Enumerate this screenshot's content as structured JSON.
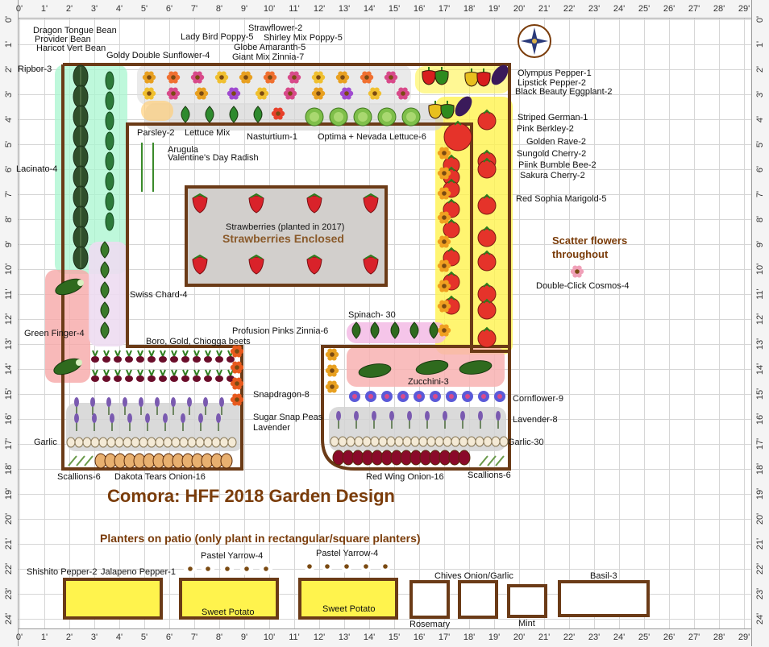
{
  "rulers": {
    "feet": [
      "0'",
      "1'",
      "2'",
      "3'",
      "4'",
      "5'",
      "6'",
      "7'",
      "8'",
      "9'",
      "10'",
      "11'",
      "12'",
      "13'",
      "14'",
      "15'",
      "16'",
      "17'",
      "18'",
      "19'",
      "20'",
      "21'",
      "22'",
      "23'",
      "24'",
      "25'",
      "26'",
      "27'",
      "28'",
      "29'"
    ],
    "rows": [
      "0'",
      "1'",
      "2'",
      "3'",
      "4'",
      "5'",
      "6'",
      "7'",
      "8'",
      "9'",
      "10'",
      "11'",
      "12'",
      "13'",
      "14'",
      "15'",
      "16'",
      "17'",
      "18'",
      "19'",
      "20'",
      "21'",
      "22'",
      "23'",
      "24'"
    ]
  },
  "title": "Comora: HFF 2018 Garden Design",
  "subtitle": "Planters on patio (only plant in rectangular/square planters)",
  "scatter_note": "Scatter flowers throughout",
  "strawberries_enclosed": "Strawberries Enclosed",
  "labels": {
    "dragon_tongue": "Dragon Tongue Bean",
    "provider": "Provider Bean",
    "haricot": "Haricot Vert Bean",
    "ripbor": "Ripbor-3",
    "goldy": "Goldy Double Sunflower-4",
    "ladybird": "Lady Bird Poppy-5",
    "strawflower": "Strawflower-2",
    "shirley": "Shirley Mix Poppy-5",
    "globe": "Globe Amaranth-5",
    "giant_zinnia": "Giant Mix Zinnia-7",
    "olympus": "Olympus Pepper-1",
    "lipstick": "Lipstick Pepper-2",
    "black_beauty": "Black Beauty Eggplant-2",
    "striped_german": "Striped German-1",
    "pink_berkley": "Pink Berkley-2",
    "golden_rave": "Golden Rave-2",
    "sungold": "Sungold Cherry-2",
    "piink_bumble": "Piink Bumble Bee-2",
    "sakura": "Sakura Cherry-2",
    "red_sophia": "Red Sophia Marigold-5",
    "parsley": "Parsley-2",
    "lettuce_mix": "Lettuce Mix",
    "nasturtium": "Nasturtium-1",
    "optima": "Optima + Nevada Lettuce-6",
    "arugula": "Arugula",
    "radish": "Valentine's Day Radish",
    "lacinato": "Lacinato-4",
    "strawberries": "Strawberries (planted in 2017)",
    "double_click": "Double-Click Cosmos-4",
    "swiss_chard": "Swiss Chard-4",
    "spinach": "Spinach- 30",
    "green_finger": "Green Finger-4",
    "profusion": "Profusion Pinks Zinnia-6",
    "beets": "Boro, Gold, Chiogga beets",
    "zucchini": "Zucchini-3",
    "snapdragon": "Snapdragon-8",
    "cornflower": "Cornflower-9",
    "sugar_snap": "Sugar Snap Peas",
    "lavender": "Lavender",
    "lavender8": "Lavender-8",
    "garlic": "Garlic",
    "garlic30": "Garlic-30",
    "scallions_left": "Scallions-6",
    "dakota": "Dakota Tears Onion-16",
    "red_wing": "Red Wing Onion-16",
    "scallions_right": "Scallions-6",
    "shishito": "Shishito Pepper-2",
    "jalapeno": "Jalapeno Pepper-1",
    "pastel_yarrow_1": "Pastel Yarrow-4",
    "pastel_yarrow_2": "Pastel Yarrow-4",
    "sweet_potato_1": "Sweet Potato",
    "sweet_potato_2": "Sweet Potato",
    "chives": "Chives Onion/Garlic",
    "rosemary": "Rosemary",
    "mint": "Mint",
    "basil": "Basil-3"
  },
  "colors": {
    "border": "#6b3b17",
    "title": "#7a3c0a",
    "highlight_yellow": "#fff34d",
    "highlight_green": "#9ff2c8",
    "highlight_pink": "#f6a8a8",
    "highlight_gray": "#c9c9c9"
  },
  "icons": [
    "compass-rose-icon",
    "tomato-icon",
    "pepper-icon",
    "eggplant-icon",
    "strawberry-icon",
    "zucchini-icon",
    "cucumber-icon",
    "kale-icon",
    "bean-icon",
    "sunflower-icon",
    "poppy-icon",
    "marigold-icon",
    "lettuce-icon",
    "beet-icon",
    "onion-icon",
    "garlic-icon",
    "lavender-icon",
    "cornflower-icon",
    "spinach-icon",
    "chard-icon",
    "yarrow-icon",
    "sweet-potato-icon",
    "rosemary-icon",
    "mint-icon",
    "basil-icon",
    "cosmos-icon"
  ]
}
